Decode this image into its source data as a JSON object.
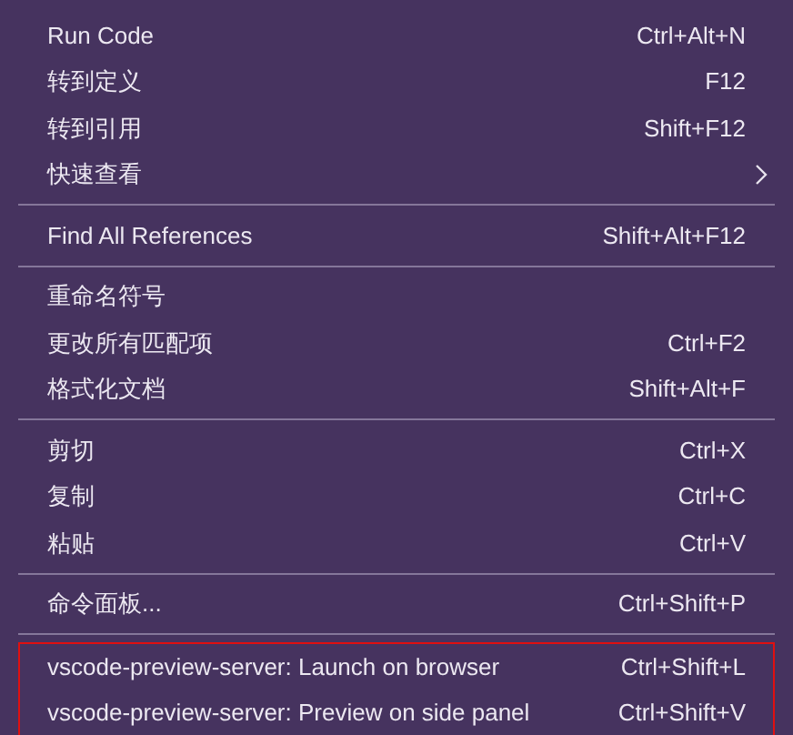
{
  "menu": {
    "groups": [
      {
        "highlighted": false,
        "items": [
          {
            "label": "Run Code",
            "shortcut": "Ctrl+Alt+N",
            "submenu": false
          },
          {
            "label": "转到定义",
            "shortcut": "F12",
            "submenu": false
          },
          {
            "label": "转到引用",
            "shortcut": "Shift+F12",
            "submenu": false
          },
          {
            "label": "快速查看",
            "submenu": true
          }
        ]
      },
      {
        "highlighted": false,
        "items": [
          {
            "label": "Find All References",
            "shortcut": "Shift+Alt+F12",
            "submenu": false
          }
        ]
      },
      {
        "highlighted": false,
        "items": [
          {
            "label": "重命名符号",
            "submenu": false
          },
          {
            "label": "更改所有匹配项",
            "shortcut": "Ctrl+F2",
            "submenu": false
          },
          {
            "label": "格式化文档",
            "shortcut": "Shift+Alt+F",
            "submenu": false
          }
        ]
      },
      {
        "highlighted": false,
        "items": [
          {
            "label": "剪切",
            "shortcut": "Ctrl+X",
            "submenu": false
          },
          {
            "label": "复制",
            "shortcut": "Ctrl+C",
            "submenu": false
          },
          {
            "label": "粘贴",
            "shortcut": "Ctrl+V",
            "submenu": false
          }
        ]
      },
      {
        "highlighted": false,
        "items": [
          {
            "label": "命令面板...",
            "shortcut": "Ctrl+Shift+P",
            "submenu": false
          }
        ]
      },
      {
        "highlighted": true,
        "items": [
          {
            "label": "vscode-preview-server: Launch on browser",
            "shortcut": "Ctrl+Shift+L",
            "submenu": false
          },
          {
            "label": "vscode-preview-server: Preview on side panel",
            "shortcut": "Ctrl+Shift+V",
            "submenu": false
          }
        ]
      }
    ]
  }
}
